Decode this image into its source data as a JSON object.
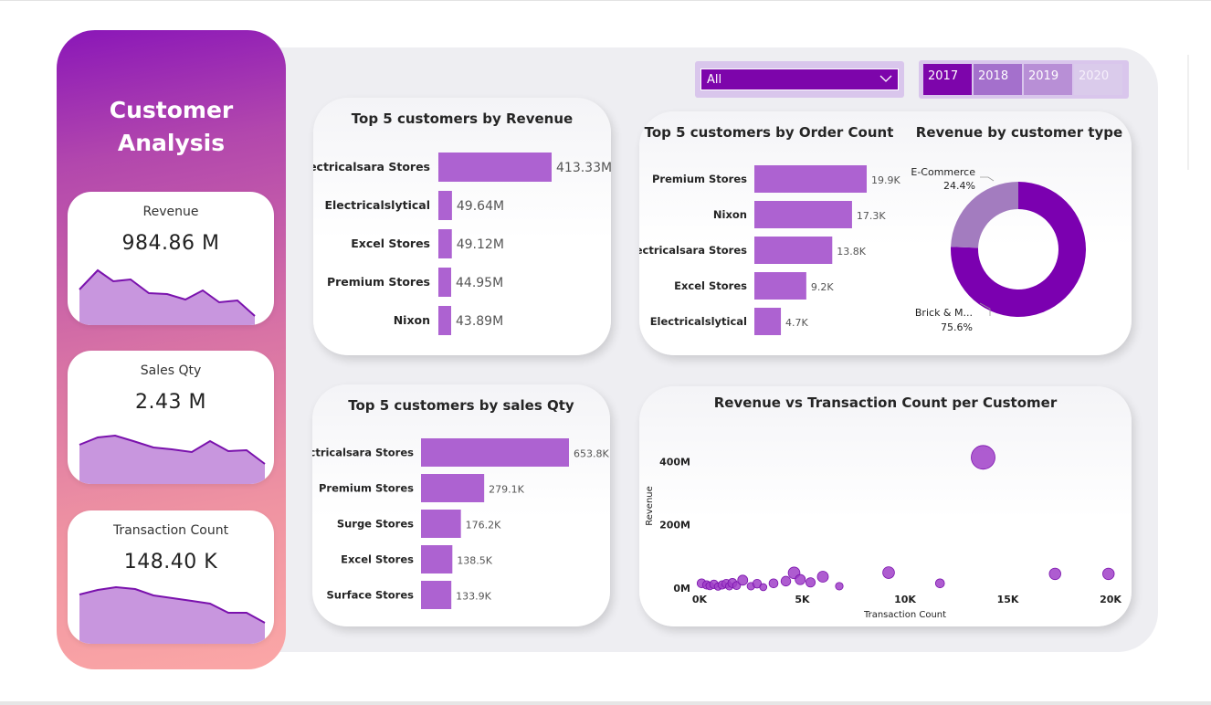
{
  "sidebar": {
    "title_line1": "Customer",
    "title_line2": "Analysis",
    "kpis": [
      {
        "label": "Revenue",
        "value": "984.86 M"
      },
      {
        "label": "Sales Qty",
        "value": "2.43 M"
      },
      {
        "label": "Transaction Count",
        "value": "148.40 K"
      }
    ]
  },
  "filters": {
    "dropdown_value": "All",
    "years": [
      {
        "label": "2017",
        "selected": true
      },
      {
        "label": "2018",
        "selected": false
      },
      {
        "label": "2019",
        "selected": false
      },
      {
        "label": "2020",
        "selected": false
      }
    ]
  },
  "colors": {
    "accent": "#7d05ab",
    "bar": "#ad62d1",
    "scatter": "#a040c8",
    "donut_main": "#7b00b0",
    "donut_minor": "#a37cbf"
  },
  "chart_data": [
    {
      "id": "top5-revenue",
      "type": "bar",
      "orientation": "horizontal",
      "title": "Top 5 customers by Revenue",
      "categories": [
        "Electricalsara Stores",
        "Electricalslytical",
        "Excel Stores",
        "Premium Stores",
        "Nixon"
      ],
      "values": [
        413.33,
        49.64,
        49.12,
        44.95,
        43.89
      ],
      "value_labels": [
        "413.33M",
        "49.64M",
        "49.12M",
        "44.95M",
        "43.89M"
      ]
    },
    {
      "id": "top5-order-count",
      "type": "bar",
      "orientation": "horizontal",
      "title": "Top 5 customers by Order Count",
      "categories": [
        "Premium Stores",
        "Nixon",
        "Electricalsara Stores",
        "Excel Stores",
        "Electricalslytical"
      ],
      "values": [
        19.9,
        17.3,
        13.8,
        9.2,
        4.7
      ],
      "value_labels": [
        "19.9K",
        "17.3K",
        "13.8K",
        "9.2K",
        "4.7K"
      ]
    },
    {
      "id": "revenue-by-type",
      "type": "pie",
      "title": "Revenue by customer type",
      "slices": [
        {
          "label": "Brick & M...",
          "value": 75.6,
          "value_label": "75.6%"
        },
        {
          "label": "E-Commerce",
          "value": 24.4,
          "value_label": "24.4%"
        }
      ]
    },
    {
      "id": "top5-sales-qty",
      "type": "bar",
      "orientation": "horizontal",
      "title": "Top 5 customers by sales Qty",
      "categories": [
        "Electricalsara Stores",
        "Premium Stores",
        "Surge Stores",
        "Excel Stores",
        "Surface Stores"
      ],
      "values": [
        653.8,
        279.1,
        176.2,
        138.5,
        133.9
      ],
      "value_labels": [
        "653.8K",
        "279.1K",
        "176.2K",
        "138.5K",
        "133.9K"
      ]
    },
    {
      "id": "revenue-vs-transactions",
      "type": "scatter",
      "title": "Revenue vs Transaction Count per Customer",
      "xlabel": "Transaction Count",
      "ylabel": "Revenue",
      "xlim": [
        0,
        20000
      ],
      "ylim": [
        0,
        450
      ],
      "x_ticks": [
        "0K",
        "5K",
        "10K",
        "15K",
        "20K"
      ],
      "y_ticks": [
        "0M",
        "200M",
        "400M"
      ],
      "points": [
        {
          "x": 100,
          "y": 15
        },
        {
          "x": 350,
          "y": 10
        },
        {
          "x": 500,
          "y": 7
        },
        {
          "x": 700,
          "y": 12
        },
        {
          "x": 900,
          "y": 5
        },
        {
          "x": 1100,
          "y": 10
        },
        {
          "x": 1300,
          "y": 14
        },
        {
          "x": 1450,
          "y": 6
        },
        {
          "x": 1600,
          "y": 16
        },
        {
          "x": 1800,
          "y": 8
        },
        {
          "x": 2100,
          "y": 25
        },
        {
          "x": 2500,
          "y": 6
        },
        {
          "x": 2800,
          "y": 14
        },
        {
          "x": 3100,
          "y": 3
        },
        {
          "x": 3600,
          "y": 15
        },
        {
          "x": 4200,
          "y": 22
        },
        {
          "x": 4600,
          "y": 48
        },
        {
          "x": 4900,
          "y": 27
        },
        {
          "x": 5400,
          "y": 18
        },
        {
          "x": 6000,
          "y": 36
        },
        {
          "x": 6800,
          "y": 6
        },
        {
          "x": 9200,
          "y": 49
        },
        {
          "x": 11700,
          "y": 15
        },
        {
          "x": 13800,
          "y": 413
        },
        {
          "x": 17300,
          "y": 45
        },
        {
          "x": 19900,
          "y": 45
        }
      ]
    }
  ]
}
